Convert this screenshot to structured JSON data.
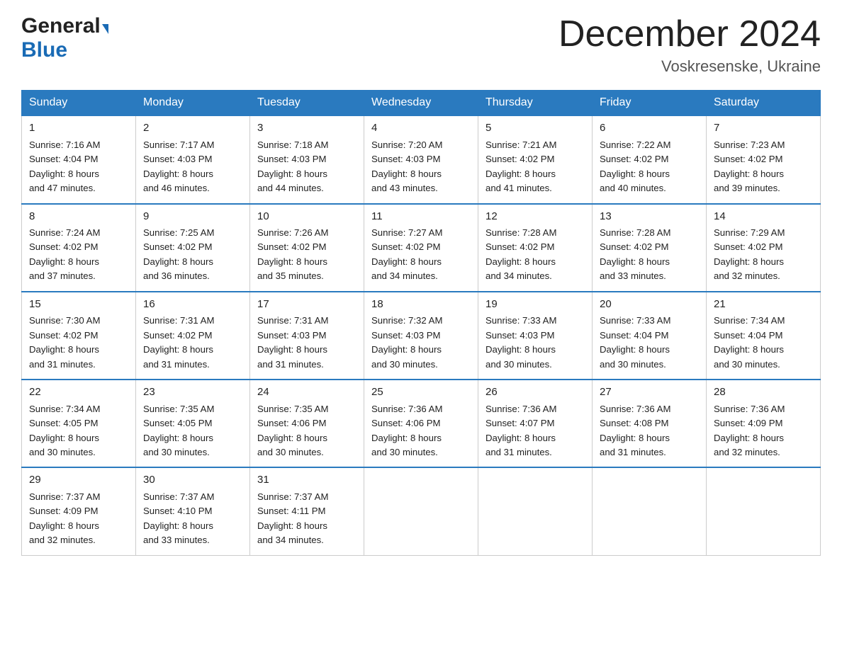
{
  "logo": {
    "general": "General",
    "blue": "Blue"
  },
  "title": "December 2024",
  "subtitle": "Voskresenske, Ukraine",
  "days_of_week": [
    "Sunday",
    "Monday",
    "Tuesday",
    "Wednesday",
    "Thursday",
    "Friday",
    "Saturday"
  ],
  "weeks": [
    [
      {
        "day": "1",
        "sunrise": "7:16 AM",
        "sunset": "4:04 PM",
        "daylight": "8 hours and 47 minutes."
      },
      {
        "day": "2",
        "sunrise": "7:17 AM",
        "sunset": "4:03 PM",
        "daylight": "8 hours and 46 minutes."
      },
      {
        "day": "3",
        "sunrise": "7:18 AM",
        "sunset": "4:03 PM",
        "daylight": "8 hours and 44 minutes."
      },
      {
        "day": "4",
        "sunrise": "7:20 AM",
        "sunset": "4:03 PM",
        "daylight": "8 hours and 43 minutes."
      },
      {
        "day": "5",
        "sunrise": "7:21 AM",
        "sunset": "4:02 PM",
        "daylight": "8 hours and 41 minutes."
      },
      {
        "day": "6",
        "sunrise": "7:22 AM",
        "sunset": "4:02 PM",
        "daylight": "8 hours and 40 minutes."
      },
      {
        "day": "7",
        "sunrise": "7:23 AM",
        "sunset": "4:02 PM",
        "daylight": "8 hours and 39 minutes."
      }
    ],
    [
      {
        "day": "8",
        "sunrise": "7:24 AM",
        "sunset": "4:02 PM",
        "daylight": "8 hours and 37 minutes."
      },
      {
        "day": "9",
        "sunrise": "7:25 AM",
        "sunset": "4:02 PM",
        "daylight": "8 hours and 36 minutes."
      },
      {
        "day": "10",
        "sunrise": "7:26 AM",
        "sunset": "4:02 PM",
        "daylight": "8 hours and 35 minutes."
      },
      {
        "day": "11",
        "sunrise": "7:27 AM",
        "sunset": "4:02 PM",
        "daylight": "8 hours and 34 minutes."
      },
      {
        "day": "12",
        "sunrise": "7:28 AM",
        "sunset": "4:02 PM",
        "daylight": "8 hours and 34 minutes."
      },
      {
        "day": "13",
        "sunrise": "7:28 AM",
        "sunset": "4:02 PM",
        "daylight": "8 hours and 33 minutes."
      },
      {
        "day": "14",
        "sunrise": "7:29 AM",
        "sunset": "4:02 PM",
        "daylight": "8 hours and 32 minutes."
      }
    ],
    [
      {
        "day": "15",
        "sunrise": "7:30 AM",
        "sunset": "4:02 PM",
        "daylight": "8 hours and 31 minutes."
      },
      {
        "day": "16",
        "sunrise": "7:31 AM",
        "sunset": "4:02 PM",
        "daylight": "8 hours and 31 minutes."
      },
      {
        "day": "17",
        "sunrise": "7:31 AM",
        "sunset": "4:03 PM",
        "daylight": "8 hours and 31 minutes."
      },
      {
        "day": "18",
        "sunrise": "7:32 AM",
        "sunset": "4:03 PM",
        "daylight": "8 hours and 30 minutes."
      },
      {
        "day": "19",
        "sunrise": "7:33 AM",
        "sunset": "4:03 PM",
        "daylight": "8 hours and 30 minutes."
      },
      {
        "day": "20",
        "sunrise": "7:33 AM",
        "sunset": "4:04 PM",
        "daylight": "8 hours and 30 minutes."
      },
      {
        "day": "21",
        "sunrise": "7:34 AM",
        "sunset": "4:04 PM",
        "daylight": "8 hours and 30 minutes."
      }
    ],
    [
      {
        "day": "22",
        "sunrise": "7:34 AM",
        "sunset": "4:05 PM",
        "daylight": "8 hours and 30 minutes."
      },
      {
        "day": "23",
        "sunrise": "7:35 AM",
        "sunset": "4:05 PM",
        "daylight": "8 hours and 30 minutes."
      },
      {
        "day": "24",
        "sunrise": "7:35 AM",
        "sunset": "4:06 PM",
        "daylight": "8 hours and 30 minutes."
      },
      {
        "day": "25",
        "sunrise": "7:36 AM",
        "sunset": "4:06 PM",
        "daylight": "8 hours and 30 minutes."
      },
      {
        "day": "26",
        "sunrise": "7:36 AM",
        "sunset": "4:07 PM",
        "daylight": "8 hours and 31 minutes."
      },
      {
        "day": "27",
        "sunrise": "7:36 AM",
        "sunset": "4:08 PM",
        "daylight": "8 hours and 31 minutes."
      },
      {
        "day": "28",
        "sunrise": "7:36 AM",
        "sunset": "4:09 PM",
        "daylight": "8 hours and 32 minutes."
      }
    ],
    [
      {
        "day": "29",
        "sunrise": "7:37 AM",
        "sunset": "4:09 PM",
        "daylight": "8 hours and 32 minutes."
      },
      {
        "day": "30",
        "sunrise": "7:37 AM",
        "sunset": "4:10 PM",
        "daylight": "8 hours and 33 minutes."
      },
      {
        "day": "31",
        "sunrise": "7:37 AM",
        "sunset": "4:11 PM",
        "daylight": "8 hours and 34 minutes."
      },
      null,
      null,
      null,
      null
    ]
  ],
  "labels": {
    "sunrise": "Sunrise:",
    "sunset": "Sunset:",
    "daylight": "Daylight:"
  }
}
